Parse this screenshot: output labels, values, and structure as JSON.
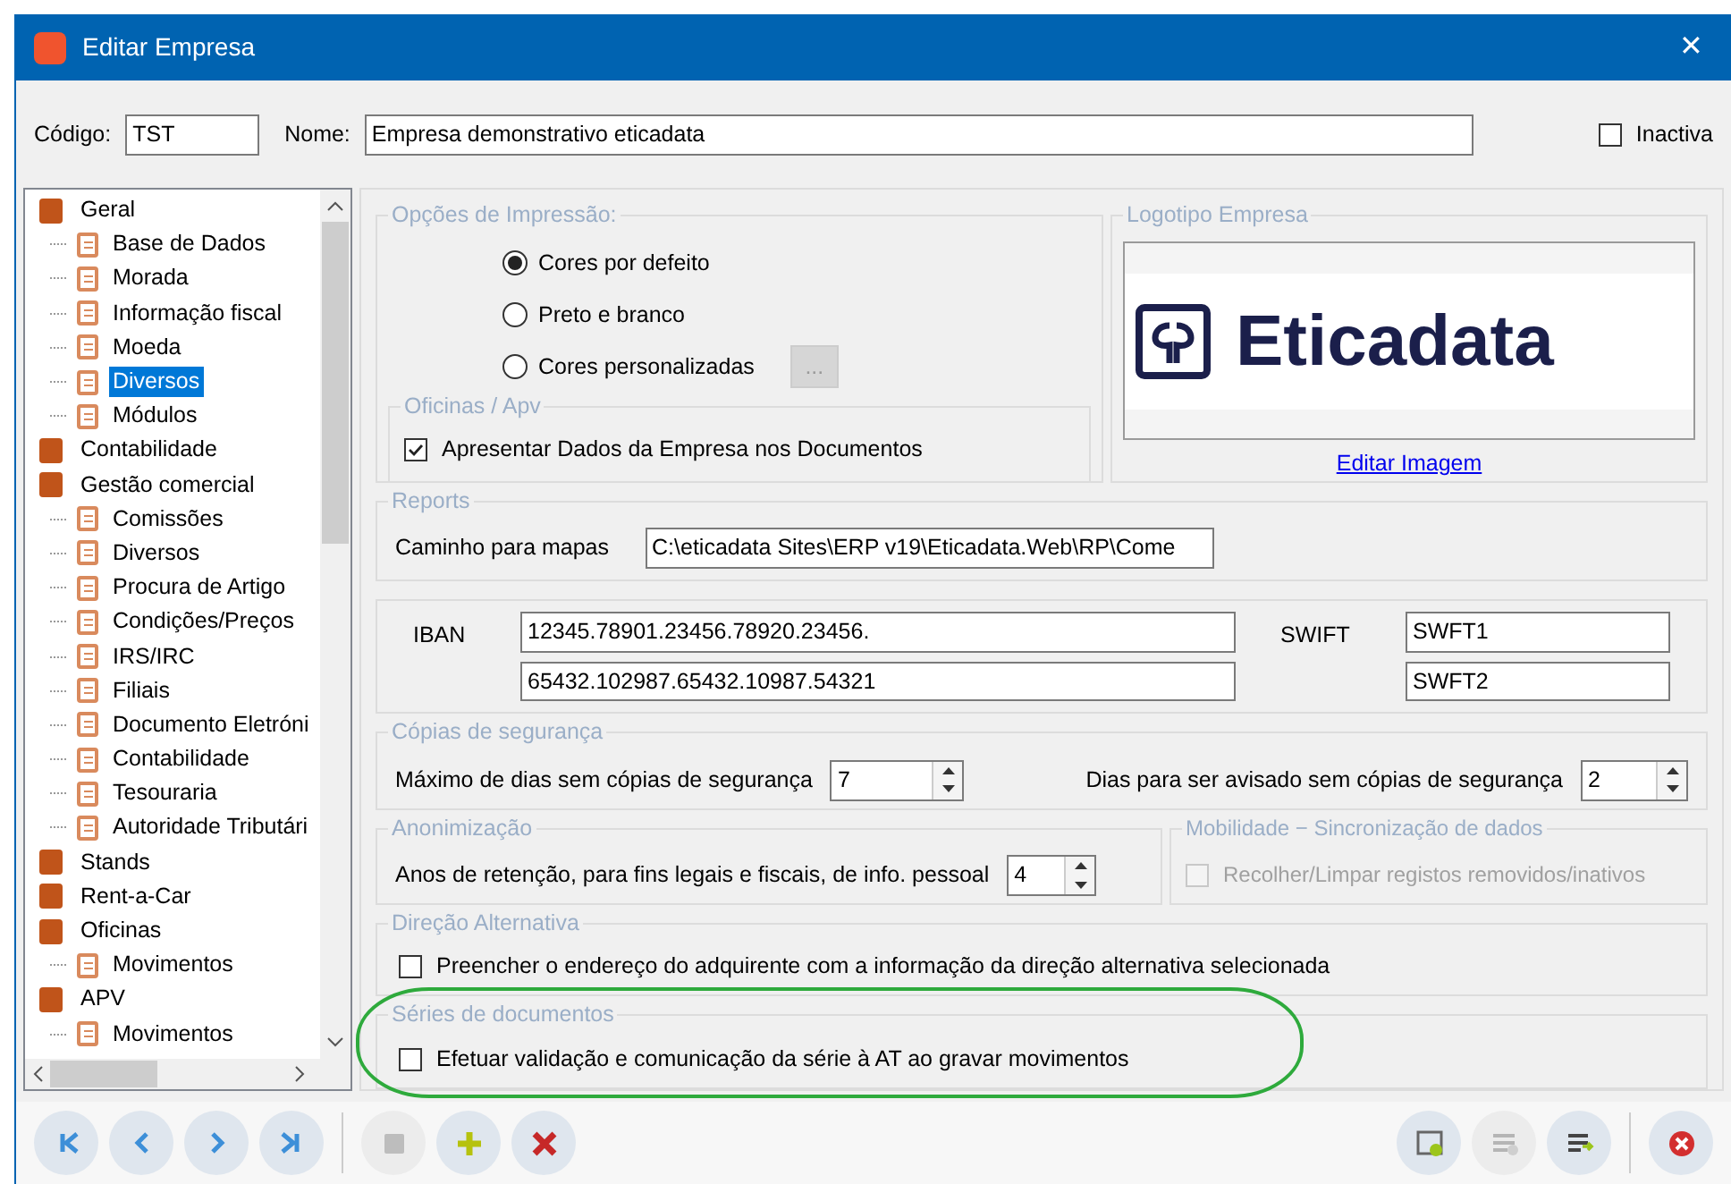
{
  "window": {
    "title": "Editar Empresa",
    "close": "✕"
  },
  "header": {
    "code_label": "Código:",
    "code_value": "TST",
    "name_label": "Nome:",
    "name_value": "Empresa demonstrativo eticadata",
    "inactive": {
      "label": "Inactiva",
      "checked": false
    }
  },
  "tree": {
    "items": [
      {
        "label": "Geral",
        "selected": false,
        "children": [
          {
            "label": "Base de Dados",
            "selected": false
          },
          {
            "label": "Morada",
            "selected": false
          },
          {
            "label": "Informação fiscal",
            "selected": false
          },
          {
            "label": "Moeda",
            "selected": false
          },
          {
            "label": "Diversos",
            "selected": true
          },
          {
            "label": "Módulos",
            "selected": false
          }
        ]
      },
      {
        "label": "Contabilidade",
        "selected": false
      },
      {
        "label": "Gestão comercial",
        "selected": false,
        "children": [
          {
            "label": "Comissões",
            "selected": false
          },
          {
            "label": "Diversos",
            "selected": false
          },
          {
            "label": "Procura de Artigo",
            "selected": false
          },
          {
            "label": "Condições/Preços",
            "selected": false
          },
          {
            "label": "IRS/IRC",
            "selected": false
          },
          {
            "label": "Filiais",
            "selected": false
          },
          {
            "label": "Documento Eletróni",
            "selected": false
          },
          {
            "label": "Contabilidade",
            "selected": false
          },
          {
            "label": "Tesouraria",
            "selected": false
          },
          {
            "label": "Autoridade Tributári",
            "selected": false
          }
        ]
      },
      {
        "label": "Stands",
        "selected": false
      },
      {
        "label": "Rent-a-Car",
        "selected": false
      },
      {
        "label": "Oficinas",
        "selected": false,
        "children": [
          {
            "label": "Movimentos",
            "selected": false
          }
        ]
      },
      {
        "label": "APV",
        "selected": false,
        "children": [
          {
            "label": "Movimentos",
            "selected": false
          }
        ]
      }
    ]
  },
  "print_options": {
    "title": "Opções de Impressão:",
    "radios": [
      {
        "label": "Cores por defeito",
        "selected": true
      },
      {
        "label": "Preto e branco",
        "selected": false
      },
      {
        "label": "Cores personalizadas",
        "selected": false
      }
    ],
    "custom_button": "...",
    "oficinas": {
      "title": "Oficinas / Apv",
      "checkbox": {
        "label": "Apresentar Dados da Empresa nos Documentos",
        "checked": true
      }
    }
  },
  "logo": {
    "title": "Logotipo Empresa",
    "logo_text": "Eticadata",
    "link": "Editar Imagem"
  },
  "reports": {
    "title": "Reports",
    "label": "Caminho para mapas",
    "value": "C:\\eticadata Sites\\ERP v19\\Eticadata.Web\\RP\\Come"
  },
  "bank": {
    "iban_label": "IBAN",
    "iban": [
      "12345.78901.23456.78920.23456.",
      "65432.102987.65432.10987.54321"
    ],
    "swift_label": "SWIFT",
    "swift": [
      "SWFT1",
      "SWFT2"
    ]
  },
  "backups": {
    "title": "Cópias de segurança",
    "fields": [
      {
        "label": "Máximo de dias sem cópias de segurança",
        "value": "7"
      },
      {
        "label": "Dias para ser avisado sem cópias de segurança",
        "value": "2"
      }
    ]
  },
  "anonymization": {
    "title": "Anonimização",
    "label": "Anos de retenção, para fins legais e fiscais, de info. pessoal",
    "value": "4"
  },
  "mobility": {
    "title": "Mobilidade − Sincronização de dados",
    "checkbox": {
      "label": "Recolher/Limpar registos removidos/inativos",
      "checked": false,
      "disabled": true
    }
  },
  "alt_direction": {
    "title": "Direção Alternativa",
    "checkbox": {
      "label": "Preencher o endereço do adquirente com a informação da direção alternativa selecionada",
      "checked": false
    }
  },
  "series": {
    "title": "Séries de documentos",
    "checkbox": {
      "label": "Efetuar validação e comunicação da série à AT ao gravar movimentos",
      "checked": false
    },
    "highlighted": true
  },
  "toolbar": {
    "left": [
      {
        "kind": "first",
        "disabled": false
      },
      {
        "kind": "prev",
        "disabled": false
      },
      {
        "kind": "next",
        "disabled": false
      },
      {
        "kind": "last",
        "disabled": false
      },
      {
        "kind": "save",
        "disabled": true
      },
      {
        "kind": "add",
        "disabled": false
      },
      {
        "kind": "delete",
        "disabled": false
      }
    ],
    "right": [
      {
        "kind": "sheet",
        "disabled": false
      },
      {
        "kind": "list",
        "disabled": true
      },
      {
        "kind": "export",
        "disabled": false
      },
      {
        "kind": "close",
        "disabled": false
      }
    ]
  }
}
